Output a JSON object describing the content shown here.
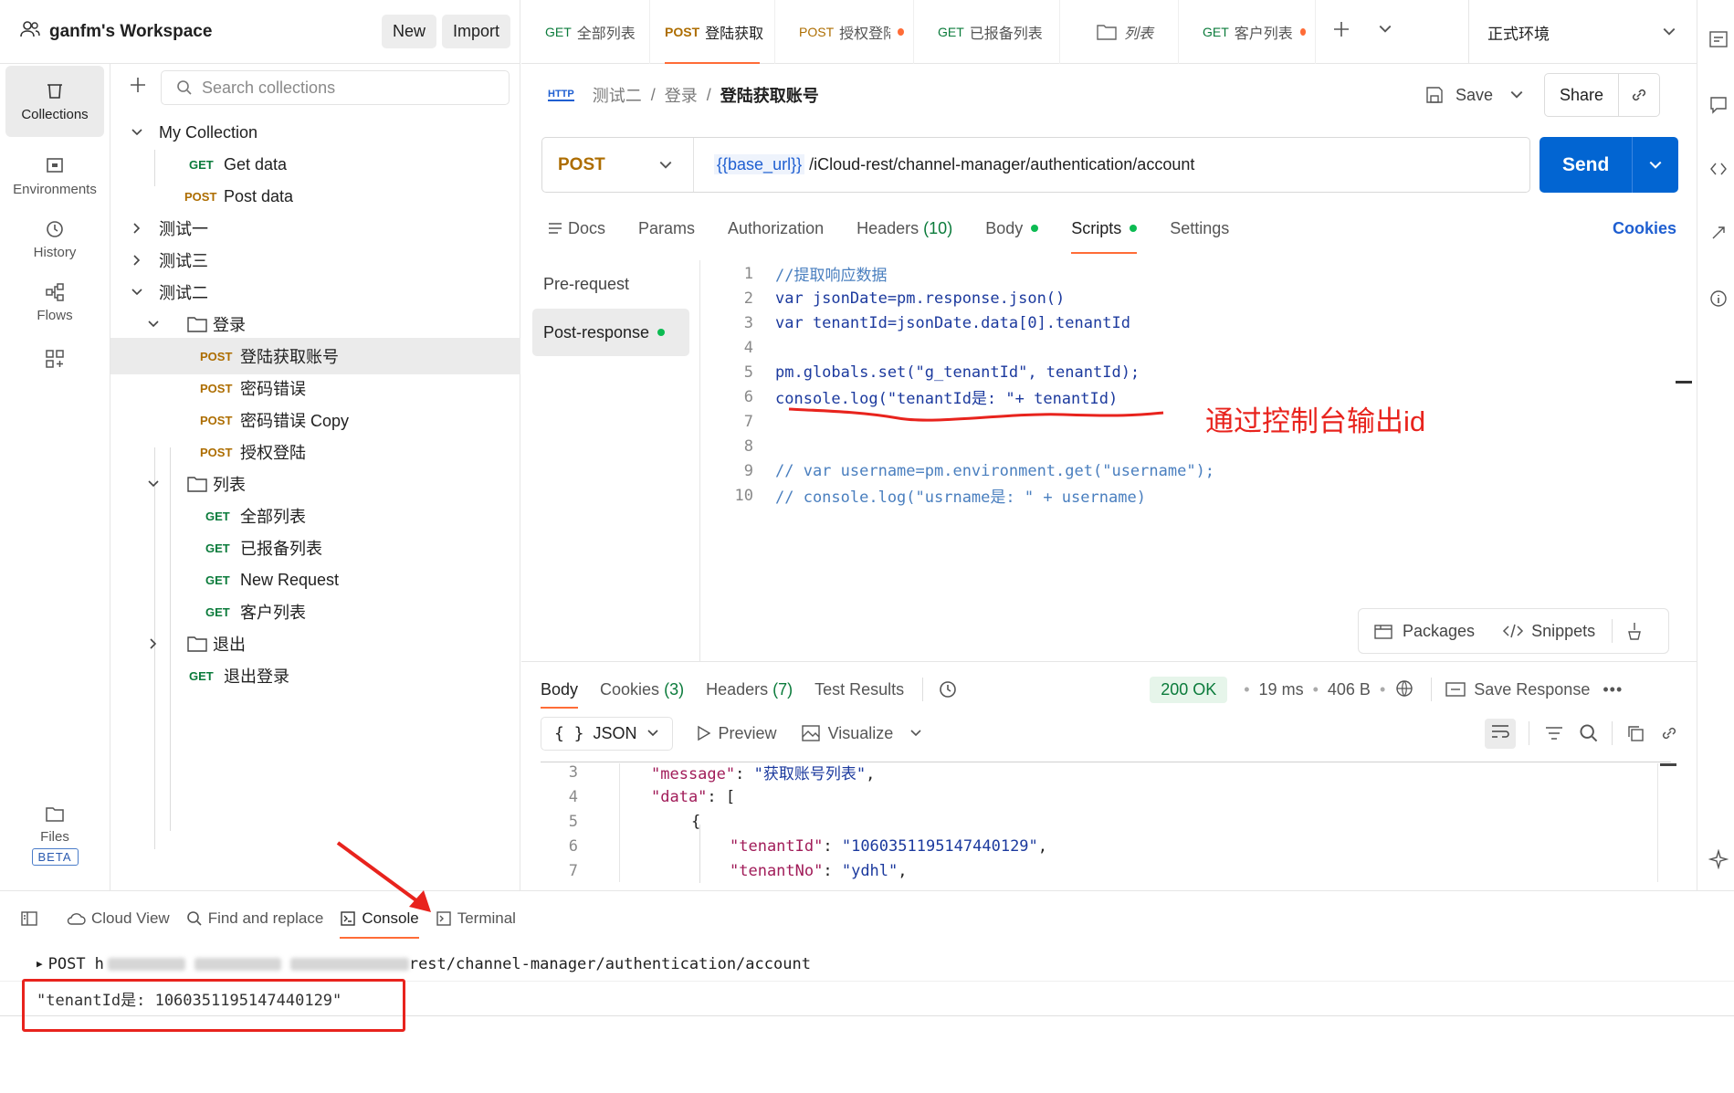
{
  "workspace": {
    "title": "ganfm's Workspace",
    "new_label": "New",
    "import_label": "Import"
  },
  "rail": {
    "collections": "Collections",
    "environments": "Environments",
    "history": "History",
    "flows": "Flows",
    "files": "Files",
    "beta": "BETA"
  },
  "sidebar": {
    "search_placeholder": "Search collections",
    "my_collection": "My Collection",
    "get_data": "Get data",
    "post_data": "Post data",
    "folder1": "测试一",
    "folder3": "测试三",
    "folder2": "测试二",
    "login_folder": "登录",
    "login_req1": "登陆获取账号",
    "login_req2": "密码错误",
    "login_req3": "密码错误 Copy",
    "login_req4": "授权登陆",
    "list_folder": "列表",
    "list_req1": "全部列表",
    "list_req2": "已报备列表",
    "list_req3": "New Request",
    "list_req4": "客户列表",
    "logout_folder": "退出",
    "logout_req": "退出登录",
    "get": "GET",
    "post": "POST"
  },
  "tabs": [
    {
      "method": "GET",
      "name": "全部列表"
    },
    {
      "method": "POST",
      "name": "登陆获取"
    },
    {
      "method": "POST",
      "name": "授权登陆"
    },
    {
      "method": "GET",
      "name": "已报备列表"
    },
    {
      "method": "",
      "name": "列表"
    },
    {
      "method": "GET",
      "name": "客户列表"
    }
  ],
  "environment": "正式环境",
  "breadcrumb": {
    "icon": "HTTP",
    "c1": "测试二",
    "c2": "登录",
    "current": "登陆获取账号"
  },
  "save_label": "Save",
  "share_label": "Share",
  "request": {
    "method": "POST",
    "url_var": "{{base_url}}",
    "url_path": " /iCloud-rest/channel-manager/authentication/account",
    "send": "Send"
  },
  "request_tabs": {
    "docs": "Docs",
    "params": "Params",
    "authorization": "Authorization",
    "headers": "Headers",
    "headers_count": "(10)",
    "body": "Body",
    "scripts": "Scripts",
    "settings": "Settings",
    "cookies": "Cookies"
  },
  "scripts": {
    "pre_request": "Pre-request",
    "post_response": "Post-response",
    "lines": [
      "//提取响应数据",
      "var jsonDate=pm.response.json()",
      "var tenantId=jsonDate.data[0].tenantId",
      "",
      "pm.globals.set(\"g_tenantId\", tenantId);",
      "console.log(\"tenantId是: \"+ tenantId)",
      "",
      "",
      "// var username=pm.environment.get(\"username\");",
      "// console.log(\"usrname是: \" + username)"
    ],
    "line_numbers": [
      "1",
      "2",
      "3",
      "4",
      "5",
      "6",
      "7",
      "8",
      "9",
      "10"
    ]
  },
  "annotation": "通过控制台输出id",
  "editor_tools": {
    "packages": "Packages",
    "snippets": "Snippets"
  },
  "response": {
    "tabs": {
      "body": "Body",
      "cookies": "Cookies",
      "cookies_count": "(3)",
      "headers": "Headers",
      "headers_count": "(7)",
      "tests": "Test Results"
    },
    "status": "200 OK",
    "time": "19 ms",
    "size": "406 B",
    "save_response": "Save Response",
    "format": "JSON",
    "preview": "Preview",
    "visualize": "Visualize",
    "line_numbers": [
      "3",
      "4",
      "5",
      "6",
      "7"
    ],
    "lines": [
      [
        "\"message\"",
        ": ",
        "\"获取账号列表\"",
        ","
      ],
      [
        "\"data\"",
        ": [",
        "",
        ""
      ],
      [
        "",
        "{",
        "",
        ""
      ],
      [
        "\"tenantId\"",
        ": ",
        "\"1060351195147440129\"",
        ","
      ],
      [
        "\"tenantNo\"",
        ": ",
        "\"ydhl\"",
        ","
      ]
    ]
  },
  "bottom": {
    "cloud_view": "Cloud View",
    "find_replace": "Find and replace",
    "console": "Console",
    "terminal": "Terminal"
  },
  "console": {
    "request_method": "POST",
    "request_url_prefix": "h",
    "request_url_suffix": "rest/channel-manager/authentication/account",
    "log_output": "\"tenantId是: 1060351195147440129\""
  },
  "colors": {
    "accent": "#ff6c37",
    "send": "#0265d2",
    "annotation": "#e8231d",
    "success": "#0b7b3b"
  }
}
